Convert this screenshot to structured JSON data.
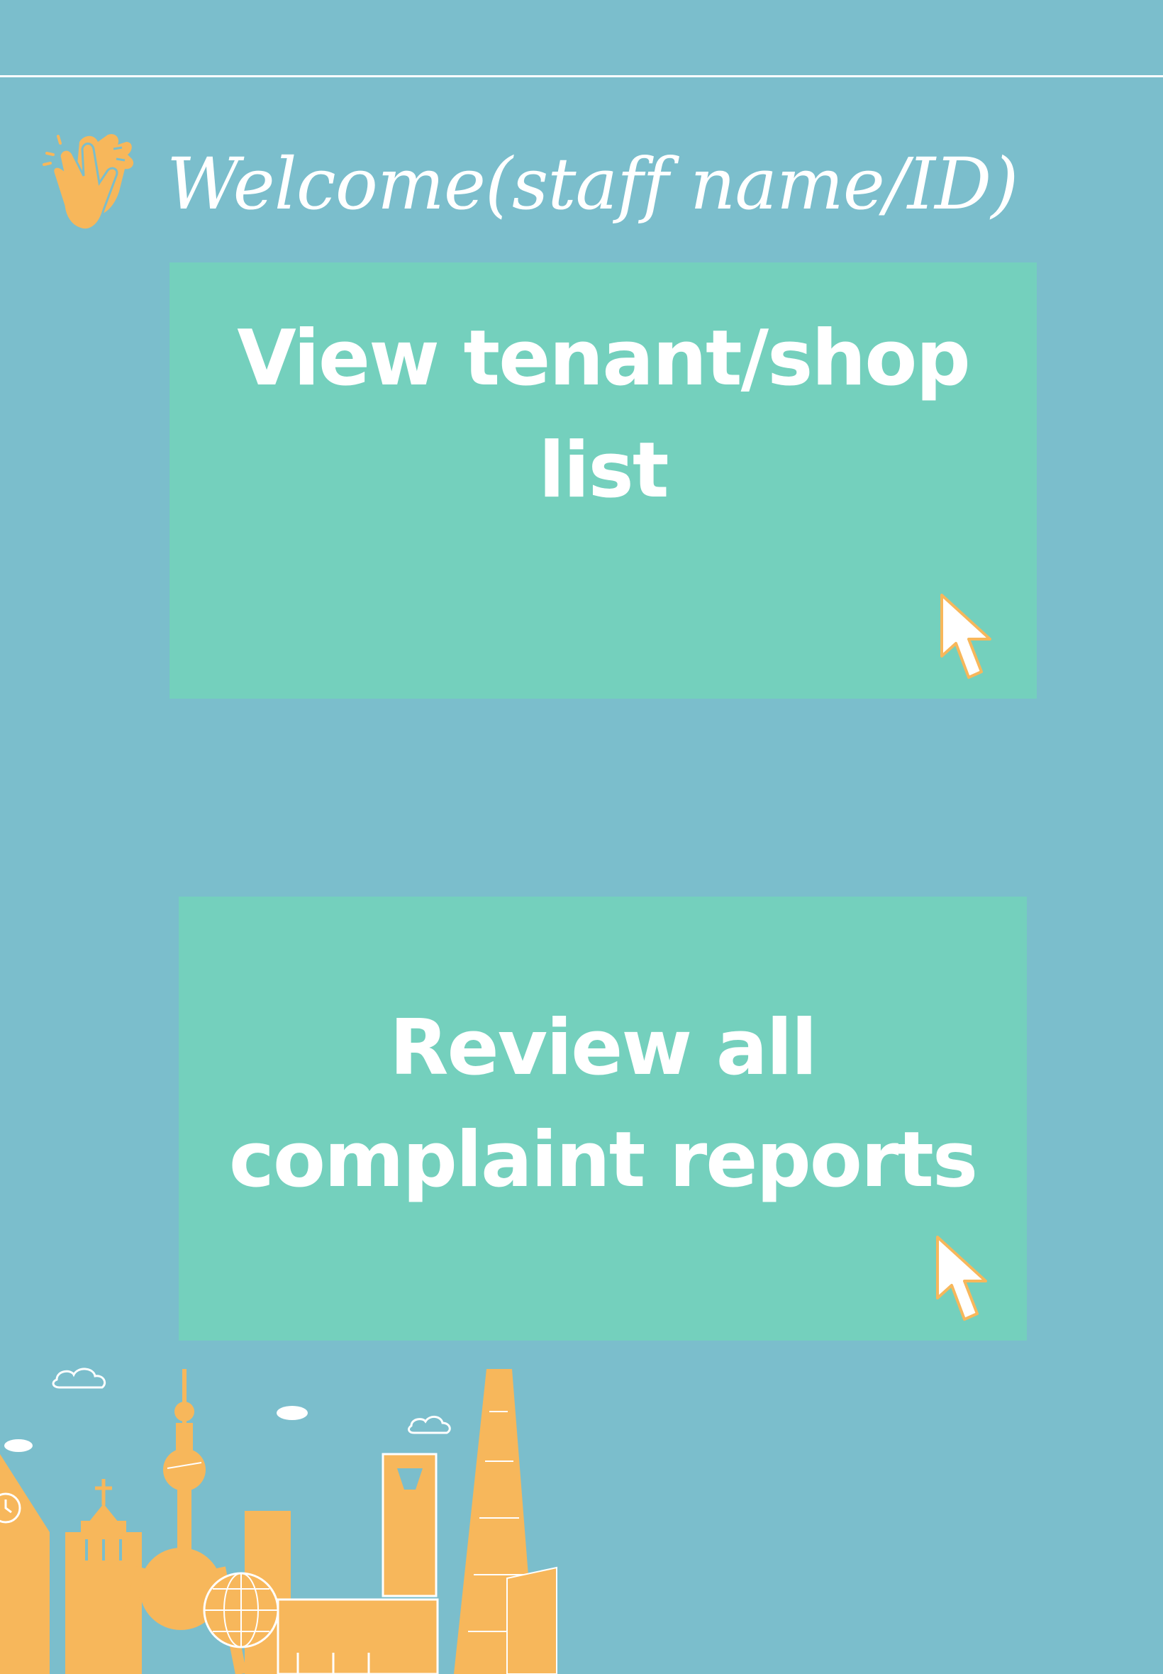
{
  "header": {
    "welcome_text": "Welcome(staff name/ID)"
  },
  "actions": [
    {
      "label": "View tenant/shop list"
    },
    {
      "label": "Review all\ncomplaint reports"
    }
  ],
  "icons": {
    "greeting": "clapping-hands-icon",
    "card_pointer": "cursor-arrow-icon",
    "illustration": "city-skyline-illustration"
  },
  "colors": {
    "background": "#7bbecc",
    "card": "#74d0bd",
    "accent": "#f7b75b",
    "text": "#ffffff"
  }
}
